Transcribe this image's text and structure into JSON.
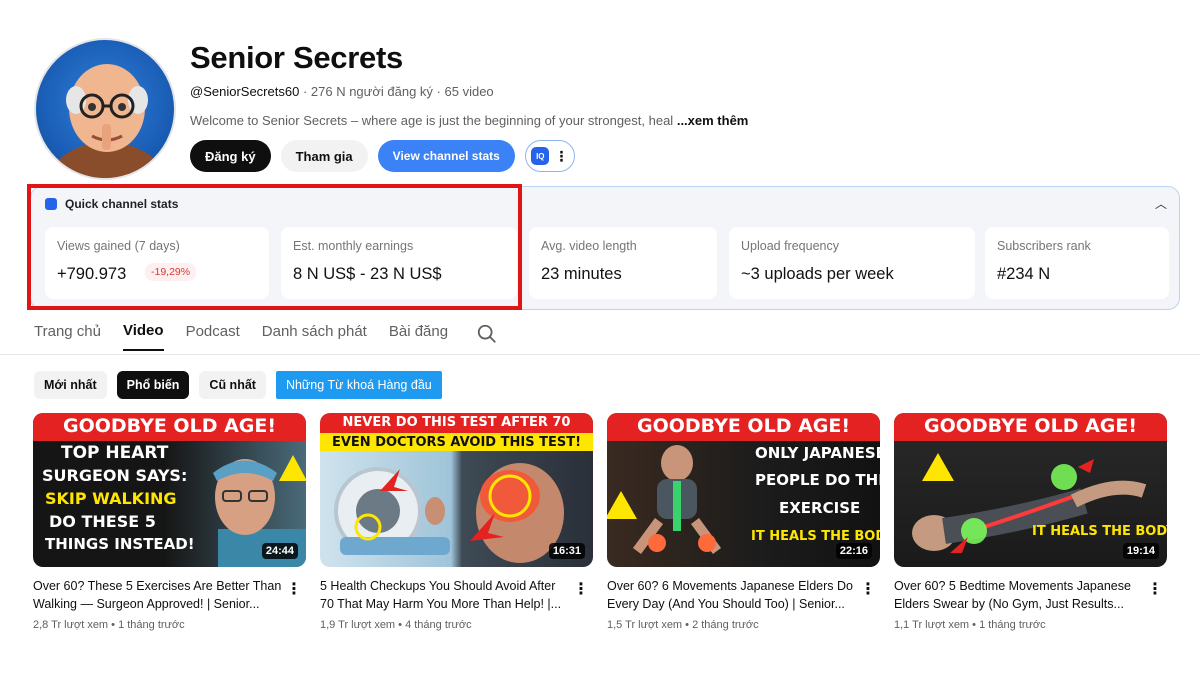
{
  "channel": {
    "name": "Senior Secrets",
    "handle": "@SeniorSecrets60",
    "subscribers": "276 N người đăng ký",
    "video_count": "65 video",
    "description": "Welcome to Senior Secrets – where age is just the beginning of your strongest, heal",
    "more_label": "...xem thêm"
  },
  "buttons": {
    "subscribe": "Đăng ký",
    "join": "Tham gia",
    "view_stats": "View channel stats",
    "iq_badge": "IQ"
  },
  "stats": {
    "header": "Quick channel stats",
    "cards": [
      {
        "label": "Views gained (7 days)",
        "value": "+790.973",
        "change": "-19,29%"
      },
      {
        "label": "Est. monthly earnings",
        "value": "8 N US$ - 23 N US$"
      },
      {
        "label": "Avg. video length",
        "value": "23 minutes"
      },
      {
        "label": "Upload frequency",
        "value": "~3 uploads per week"
      },
      {
        "label": "Subscribers rank",
        "value": "#234 N"
      }
    ]
  },
  "tabs": [
    "Trang chủ",
    "Video",
    "Podcast",
    "Danh sách phát",
    "Bài đăng"
  ],
  "active_tab": "Video",
  "filters": [
    "Mới nhất",
    "Phổ biến",
    "Cũ nhất",
    "Những Từ khoá Hàng đầu"
  ],
  "active_filter": "Phổ biến",
  "videos": [
    {
      "title": "Over 60? These 5 Exercises Are Better Than Walking — Surgeon Approved! | Senior...",
      "views": "2,8 Tr lượt xem",
      "age": "1 tháng trước",
      "duration": "24:44",
      "thumb_lines": [
        "GOODBYE OLD AGE!",
        "TOP HEART",
        "SURGEON SAYS:",
        "SKIP WALKING",
        "DO THESE 5",
        "THINGS INSTEAD!"
      ]
    },
    {
      "title": "5 Health Checkups You Should Avoid After 70 That May Harm You More Than Help! |...",
      "views": "1,9 Tr lượt xem",
      "age": "4 tháng trước",
      "duration": "16:31",
      "thumb_lines": [
        "NEVER DO THIS TEST AFTER 70",
        "EVEN DOCTORS AVOID THIS TEST!"
      ]
    },
    {
      "title": "Over 60? 6 Movements Japanese Elders Do Every Day (And You Should Too) | Senior...",
      "views": "1,5 Tr lượt xem",
      "age": "2 tháng trước",
      "duration": "22:16",
      "thumb_lines": [
        "GOODBYE OLD AGE!",
        "ONLY JAPANESE",
        "PEOPLE DO THIS",
        "EXERCISE",
        "IT HEALS THE BODY"
      ]
    },
    {
      "title": "Over 60? 5 Bedtime Movements Japanese Elders Swear by (No Gym, Just Results...",
      "views": "1,1 Tr lượt xem",
      "age": "1 tháng trước",
      "duration": "19:14",
      "thumb_lines": [
        "GOODBYE OLD AGE!",
        "IT HEALS THE BODY!"
      ]
    }
  ],
  "colors": {
    "accent_blue": "#3b82f6",
    "highlight_red": "#e01616",
    "thumb_red": "#e52222",
    "thumb_yellow": "#ffe600"
  }
}
